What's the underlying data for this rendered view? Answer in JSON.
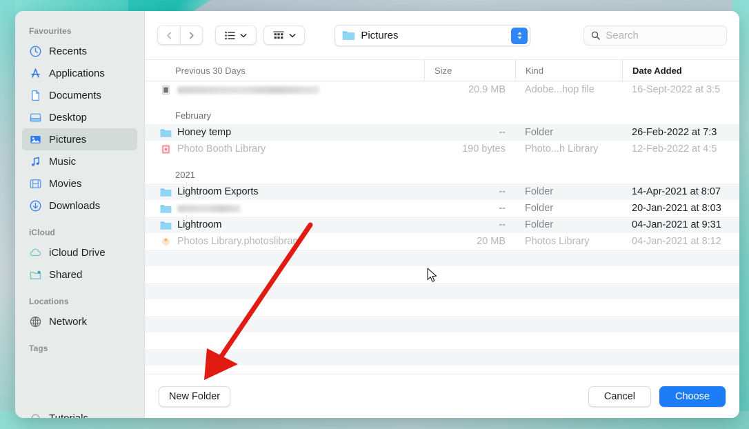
{
  "window": {
    "title": "Open / Choose folder dialog",
    "accent_color": "#1d7df7",
    "sidebar_selected_bg": "#d3dbd9",
    "backdrop_color": "#5ccfc3",
    "annotation_color": "#e01b12"
  },
  "sidebar": {
    "sections": [
      {
        "title": "Favourites",
        "items": [
          {
            "label": "Recents",
            "icon": "clock-icon",
            "selected": false
          },
          {
            "label": "Applications",
            "icon": "applications-icon",
            "selected": false
          },
          {
            "label": "Documents",
            "icon": "document-icon",
            "selected": false
          },
          {
            "label": "Desktop",
            "icon": "desktop-icon",
            "selected": false
          },
          {
            "label": "Pictures",
            "icon": "pictures-icon",
            "selected": true
          },
          {
            "label": "Music",
            "icon": "music-note-icon",
            "selected": false
          },
          {
            "label": "Movies",
            "icon": "film-icon",
            "selected": false
          },
          {
            "label": "Downloads",
            "icon": "download-icon",
            "selected": false
          }
        ]
      },
      {
        "title": "iCloud",
        "items": [
          {
            "label": "iCloud Drive",
            "icon": "cloud-icon",
            "selected": false
          },
          {
            "label": "Shared",
            "icon": "shared-folder-icon",
            "selected": false
          }
        ]
      },
      {
        "title": "Locations",
        "items": [
          {
            "label": "Network",
            "icon": "globe-icon",
            "selected": false
          }
        ]
      },
      {
        "title": "Tags",
        "items": [
          {
            "label": "Tutorials",
            "icon": "tag-dot-icon",
            "selected": false
          }
        ]
      }
    ]
  },
  "toolbar": {
    "back_icon": "chevron-left-icon",
    "forward_icon": "chevron-right-icon",
    "list_view_icon": "list-view-icon",
    "grid_view_icon": "grid-view-icon",
    "view_caret_icon": "chevron-down-icon",
    "path_label": "Pictures",
    "path_icon": "folder-icon",
    "path_stepper_icon": "stepper-updown-icon",
    "search": {
      "icon": "search-icon",
      "placeholder": "Search",
      "value": ""
    }
  },
  "columns": {
    "name": "Previous 30 Days",
    "size": "Size",
    "kind": "Kind",
    "date": "Date Added"
  },
  "file_list": [
    {
      "type": "file",
      "name": "",
      "name_blurred": true,
      "blur_width": 206,
      "icon": "photoshop-file-icon",
      "size": "20.9 MB",
      "kind": "Adobe...hop file",
      "date": "16-Sept-2022 at 3:5",
      "dim": true,
      "alt": false
    },
    {
      "type": "group",
      "label": "February"
    },
    {
      "type": "folder",
      "name": "Honey temp",
      "name_blurred": false,
      "icon": "folder-icon",
      "size": "--",
      "kind": "Folder",
      "date": "26-Feb-2022 at 7:3",
      "dim": false,
      "alt": true
    },
    {
      "type": "file",
      "name": "Photo Booth Library",
      "name_blurred": false,
      "icon": "photobooth-icon",
      "size": "190 bytes",
      "kind": "Photo...h Library",
      "date": "12-Feb-2022 at 4:5",
      "dim": true,
      "alt": false
    },
    {
      "type": "group",
      "label": "2021"
    },
    {
      "type": "folder",
      "name": "Lightroom Exports",
      "name_blurred": false,
      "icon": "folder-icon",
      "size": "--",
      "kind": "Folder",
      "date": "14-Apr-2021 at 8:07",
      "dim": false,
      "alt": true
    },
    {
      "type": "folder",
      "name": "",
      "name_blurred": true,
      "blur_width": 92,
      "icon": "folder-icon",
      "size": "--",
      "kind": "Folder",
      "date": "20-Jan-2021 at 8:03",
      "dim": false,
      "alt": false
    },
    {
      "type": "folder",
      "name": "Lightroom",
      "name_blurred": false,
      "icon": "folder-icon",
      "size": "--",
      "kind": "Folder",
      "date": "04-Jan-2021 at 9:31",
      "dim": false,
      "alt": true
    },
    {
      "type": "file",
      "name": "Photos Library.photoslibrary",
      "name_blurred": false,
      "icon": "photos-library-icon",
      "size": "20 MB",
      "kind": "Photos Library",
      "date": "04-Jan-2021 at 8:12",
      "dim": true,
      "alt": false
    }
  ],
  "buttons": {
    "new_folder": "New Folder",
    "cancel": "Cancel",
    "choose": "Choose"
  },
  "annotation": {
    "type": "arrow",
    "points_to": "New Folder",
    "color": "#e01b12"
  }
}
